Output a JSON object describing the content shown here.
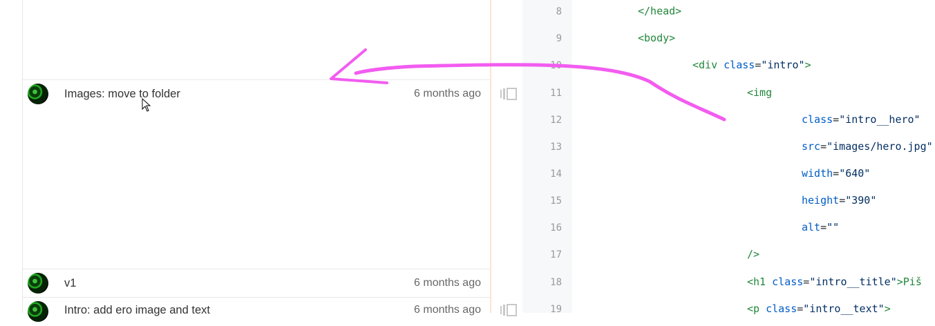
{
  "commits": [
    {
      "message": "Images: move to folder",
      "age": "6 months ago"
    },
    {
      "message": "v1",
      "age": "6 months ago"
    },
    {
      "message": "Intro: add ero image and text",
      "age": "6 months ago"
    }
  ],
  "line_numbers": [
    "8",
    "9",
    "10",
    "11",
    "12",
    "13",
    "14",
    "15",
    "16",
    "17",
    "18",
    "19"
  ],
  "code": {
    "l8": {
      "tag": "</head>"
    },
    "l9": {
      "tag": "<body>"
    },
    "l10": {
      "open": "<div",
      "attr": "class",
      "eq": "=",
      "val": "\"intro\"",
      "close": ">"
    },
    "l11": {
      "tag": "<img"
    },
    "l12": {
      "attr": "class",
      "eq": "=",
      "val": "\"intro__hero\""
    },
    "l13": {
      "attr": "src",
      "eq": "=",
      "val": "\"images/hero.jpg\""
    },
    "l14": {
      "attr": "width",
      "eq": "=",
      "val": "\"640\""
    },
    "l15": {
      "attr": "height",
      "eq": "=",
      "val": "\"390\""
    },
    "l16": {
      "attr": "alt",
      "eq": "=",
      "val": "\"\""
    },
    "l17": {
      "tag": "/>"
    },
    "l18": {
      "open": "<h1",
      "attr": "class",
      "eq": "=",
      "val": "\"intro__title\"",
      "close": ">Piš"
    },
    "l19": {
      "open": "<p",
      "attr": "class",
      "eq": "=",
      "val": "\"intro__text\"",
      "close": ">"
    }
  },
  "annotation": {
    "color": "#f25cf0",
    "shape": "arrow pointing left"
  },
  "icons": [
    "avatar",
    "history-icon",
    "mouse-cursor-icon"
  ]
}
